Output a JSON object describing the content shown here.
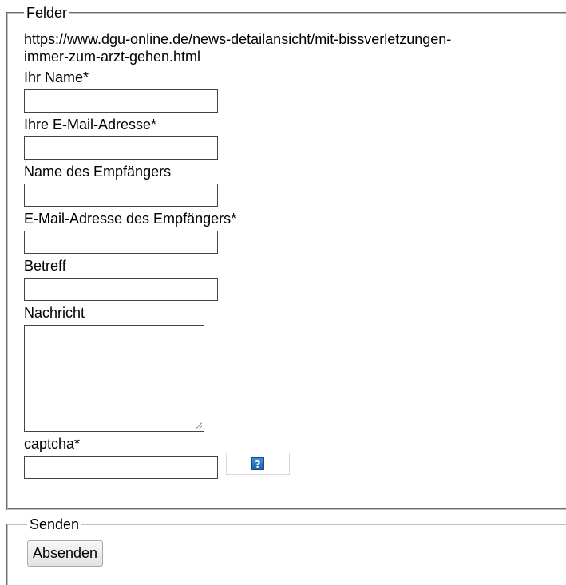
{
  "fields_fieldset": {
    "legend": "Felder",
    "url": "https://www.dgu-online.de/news-detailansicht/mit-bissverletzungen-immer-zum-arzt-gehen.html",
    "your_name": {
      "label": "Ihr Name*",
      "value": ""
    },
    "your_email": {
      "label": "Ihre E-Mail-Adresse*",
      "value": ""
    },
    "recipient_name": {
      "label": "Name des Empfängers",
      "value": ""
    },
    "recipient_email": {
      "label": "E-Mail-Adresse des Empfängers*",
      "value": ""
    },
    "subject": {
      "label": "Betreff",
      "value": ""
    },
    "message": {
      "label": "Nachricht",
      "value": ""
    },
    "captcha": {
      "label": "captcha*",
      "value": "",
      "image_icon": "question-mark-icon",
      "image_glyph": "?"
    }
  },
  "send_fieldset": {
    "legend": "Senden",
    "submit_label": "Absenden"
  },
  "colors": {
    "help_icon": "#2a74c6",
    "border": "#c0c0c0"
  }
}
